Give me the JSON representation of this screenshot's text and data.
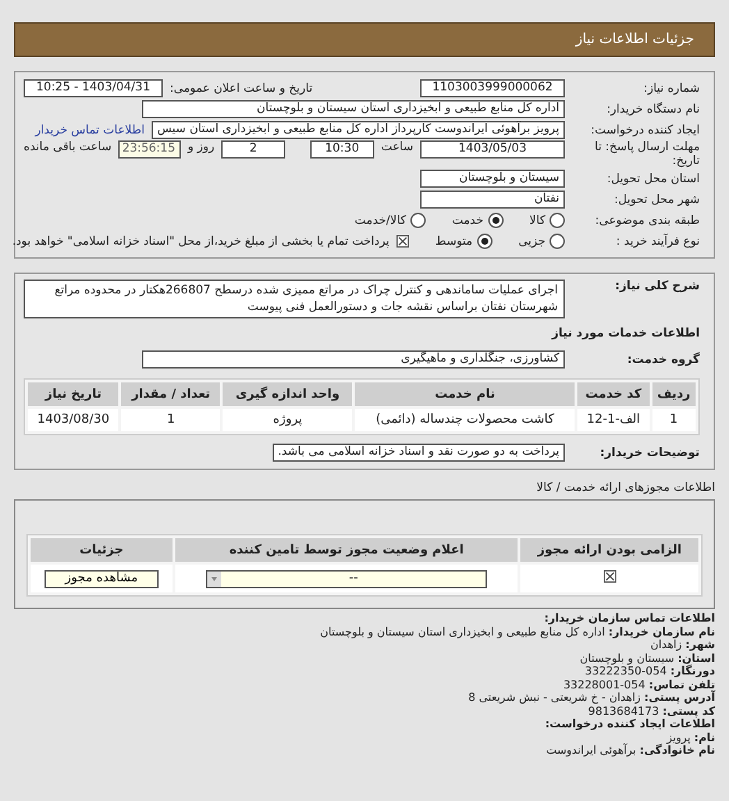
{
  "header": {
    "title": "جزئیات اطلاعات نیاز"
  },
  "details": {
    "need_number": {
      "label": "شماره نیاز:",
      "value": "1103003999000062"
    },
    "announce": {
      "label": "تاریخ و ساعت اعلان عمومی:",
      "value": "1403/04/31 - 10:25"
    },
    "buyer": {
      "label": "نام دستگاه خریدار:",
      "value": "اداره کل منابع طبیعی و ابخیزداری استان سیستان و بلوچستان"
    },
    "creator": {
      "label": "ایجاد کننده درخواست:",
      "value": "پرویز برآهوئی ایراندوست کارپرداز اداره کل منابع طبیعی و ابخیزداری استان سیس",
      "link": "اطلاعات تماس خریدار"
    },
    "deadline": {
      "label": "مهلت ارسال پاسخ: تا تاریخ:",
      "date": "1403/05/03",
      "time_label": "ساعت",
      "time": "10:30",
      "days": "2",
      "days_label": "روز و",
      "remaining": "23:56:15",
      "remaining_label": "ساعت باقی مانده"
    },
    "province": {
      "label": "استان محل تحویل:",
      "value": "سیستان و بلوچستان"
    },
    "city": {
      "label": "شهر محل تحویل:",
      "value": "نفتان"
    },
    "category": {
      "label": "طبقه بندی موضوعی:",
      "options": [
        {
          "label": "کالا",
          "selected": false
        },
        {
          "label": "خدمت",
          "selected": true
        },
        {
          "label": "کالا/خدمت",
          "selected": false
        }
      ]
    },
    "purchase_type": {
      "label": "نوع فرآیند خرید :",
      "options": [
        {
          "label": "جزیی",
          "selected": false
        },
        {
          "label": "متوسط",
          "selected": true
        }
      ],
      "payment_checked": true,
      "payment_note": "پرداخت تمام یا بخشی از مبلغ خرید،از محل \"اسناد خزانه اسلامی\" خواهد بود."
    }
  },
  "description": {
    "label": "شرح کلی نیاز:",
    "value": "اجرای عملیات ساماندهی و کنترل چراک در مراتع ممیزی شده درسطح 266807هکتار در محدوده مراتع شهرستان نفتان براساس نقشه جات و دستورالعمل فنی پیوست"
  },
  "services": {
    "title": "اطلاعات خدمات مورد نیاز",
    "group_label": "گروه خدمت:",
    "group_value": "کشاورزی، جنگلداری و ماهیگیری",
    "columns": [
      "ردیف",
      "کد خدمت",
      "نام خدمت",
      "واحد اندازه گیری",
      "تعداد / مقدار",
      "تاریخ نیاز"
    ],
    "rows": [
      [
        "1",
        "الف-1-12",
        "کاشت محصولات چندساله (دائمی)",
        "پروژه",
        "1",
        "1403/08/30"
      ]
    ]
  },
  "buyer_notes": {
    "label": "توضیحات خریدار:",
    "value": "پرداخت به دو صورت نقد و اسناد خزانه اسلامی می باشد."
  },
  "licenses": {
    "title": "اطلاعات مجوزهای ارائه خدمت / کالا",
    "columns": [
      "الزامی بودن ارائه مجوز",
      "اعلام وضعیت مجوز توسط تامین کننده",
      "جزئیات"
    ],
    "rows": [
      {
        "required": true,
        "status": "--",
        "button": "مشاهده مجوز"
      }
    ]
  },
  "contact": {
    "title": "اطلاعات تماس سازمان خریدار:",
    "fields": [
      {
        "label": "نام سازمان خریدار:",
        "value": "اداره کل منابع طبیعی و ابخیزداری استان سیستان و بلوچستان"
      },
      {
        "label": "شهر:",
        "value": "زاهدان"
      },
      {
        "label": "استان:",
        "value": "سیستان و بلوچستان"
      },
      {
        "label": "دورنگار:",
        "value": "054-33222350"
      },
      {
        "label": "تلفن تماس:",
        "value": "054-33228001"
      },
      {
        "label": "آدرس پستی:",
        "value": "زاهدان - خ شریعتی - نبش شریعتی 8"
      },
      {
        "label": "کد پستی:",
        "value": "9813684173"
      }
    ],
    "creator_title": "اطلاعات ایجاد کننده درخواست:",
    "creator_fields": [
      {
        "label": "نام:",
        "value": "پرویز"
      },
      {
        "label": "نام خانوادگی:",
        "value": "برآهوئی ایراندوست"
      }
    ]
  }
}
